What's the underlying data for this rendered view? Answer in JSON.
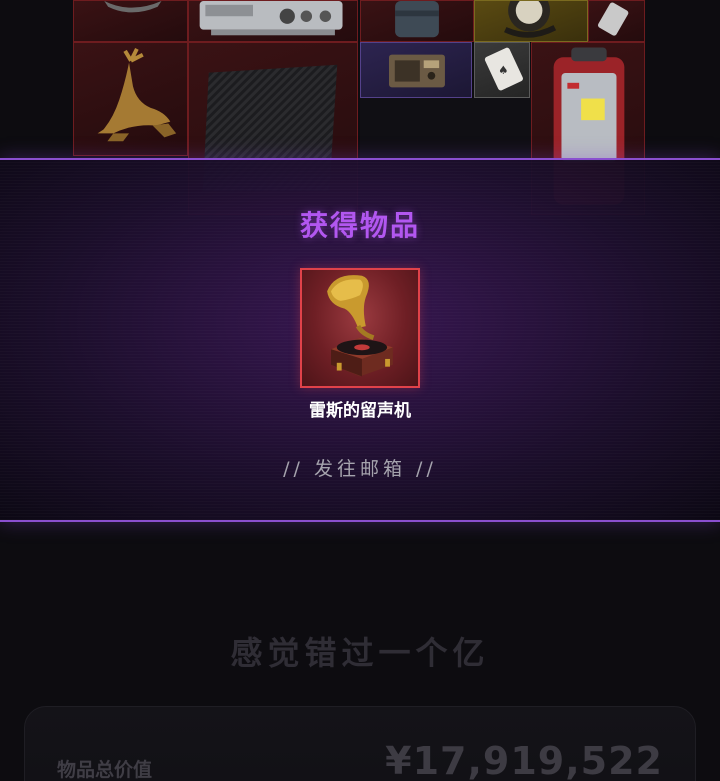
{
  "inventory": {
    "slots": [
      {
        "icon": "helmet-icon",
        "rarity": "red"
      },
      {
        "icon": "machine-icon",
        "rarity": "red"
      },
      {
        "icon": "canister-icon",
        "rarity": "red"
      },
      {
        "icon": "watch-icon",
        "rarity": "gold"
      },
      {
        "icon": "drive-icon",
        "rarity": "red"
      },
      {
        "icon": "deer-statue-icon",
        "rarity": "red"
      },
      {
        "icon": "carbon-plate-icon",
        "rarity": "red"
      },
      {
        "icon": "radio-icon",
        "rarity": "purple"
      },
      {
        "icon": "playing-card-icon",
        "rarity": "grey"
      },
      {
        "icon": "backpack-icon",
        "rarity": "red"
      }
    ]
  },
  "reward": {
    "title": "获得物品",
    "item_name": "雷斯的留声机",
    "item_icon": "gramophone-icon",
    "rarity_color": "#e0424a",
    "action_label": "// 发往邮箱 //"
  },
  "summary": {
    "slogan": "感觉错过一个亿",
    "value_label": "物品总价值",
    "value_amount": "¥17,919,522"
  },
  "colors": {
    "accent_purple": "#b257f0",
    "banner_border": "#8a4fcf",
    "rarity_red": "#e0424a",
    "rarity_gold": "#7a6a1f",
    "rarity_purple": "#54418a"
  }
}
